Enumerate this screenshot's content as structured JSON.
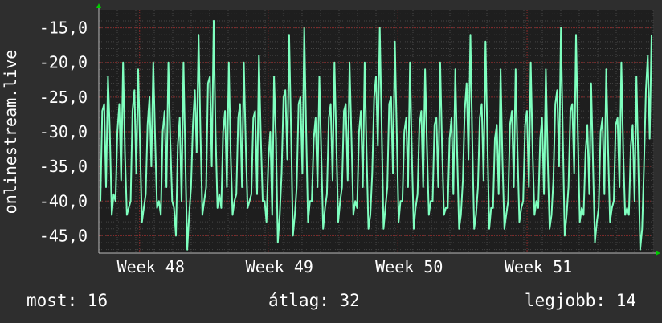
{
  "chart_data": {
    "type": "line",
    "ylabel": "onlinestream.live",
    "ylim": [
      -47.5,
      -12.5
    ],
    "y_ticks": [
      {
        "value": -15,
        "label": "-15,0"
      },
      {
        "value": -20,
        "label": "-20,0"
      },
      {
        "value": -25,
        "label": "-25,0"
      },
      {
        "value": -30,
        "label": "-30,0"
      },
      {
        "value": -35,
        "label": "-35,0"
      },
      {
        "value": -40,
        "label": "-40,0"
      },
      {
        "value": -45,
        "label": "-45,0"
      }
    ],
    "x_ticks": [
      "Week 48",
      "Week 49",
      "Week 50",
      "Week 51"
    ],
    "x_tick_positions": [
      0.146,
      0.378,
      0.612,
      0.845
    ],
    "grid": true,
    "series": [
      {
        "color": "#7fffbf",
        "values": [
          -40,
          -27,
          -26,
          -38,
          -22,
          -30,
          -42,
          -39,
          -40,
          -30,
          -26,
          -37,
          -20,
          -33,
          -42,
          -41,
          -40,
          -27,
          -24,
          -36,
          -21,
          -32,
          -43,
          -41,
          -39,
          -29,
          -25,
          -35,
          -20,
          -31,
          -41,
          -40,
          -42,
          -30,
          -27,
          -38,
          -20,
          -31,
          -40,
          -41,
          -45,
          -32,
          -28,
          -40,
          -20,
          -34,
          -47,
          -42,
          -38,
          -29,
          -24,
          -33,
          -16,
          -30,
          -42,
          -40,
          -38,
          -23,
          -22,
          -35,
          -14,
          -30,
          -41,
          -39,
          -41,
          -30,
          -27,
          -38,
          -20,
          -33,
          -42,
          -40,
          -39,
          -28,
          -26,
          -38,
          -20,
          -32,
          -41,
          -40,
          -39,
          -28,
          -27,
          -39,
          -19,
          -31,
          -40,
          -40,
          -43,
          -34,
          -30,
          -42,
          -22,
          -31,
          -46,
          -42,
          -36,
          -25,
          -24,
          -34,
          -16,
          -30,
          -45,
          -42,
          -38,
          -26,
          -25,
          -36,
          -15,
          -30,
          -43,
          -40,
          -40,
          -31,
          -28,
          -38,
          -22,
          -33,
          -44,
          -41,
          -39,
          -28,
          -26,
          -37,
          -20,
          -32,
          -43,
          -40,
          -38,
          -27,
          -26,
          -37,
          -20,
          -31,
          -42,
          -40,
          -41,
          -30,
          -27,
          -38,
          -20,
          -33,
          -44,
          -42,
          -36,
          -25,
          -22,
          -32,
          -15,
          -29,
          -44,
          -41,
          -38,
          -26,
          -25,
          -36,
          -17,
          -30,
          -43,
          -40,
          -40,
          -30,
          -28,
          -38,
          -20,
          -33,
          -44,
          -41,
          -39,
          -29,
          -27,
          -38,
          -21,
          -32,
          -42,
          -40,
          -40,
          -29,
          -28,
          -38,
          -20,
          -32,
          -42,
          -41,
          -41,
          -31,
          -28,
          -39,
          -21,
          -33,
          -44,
          -42,
          -37,
          -27,
          -23,
          -34,
          -16,
          -31,
          -44,
          -42,
          -38,
          -28,
          -26,
          -37,
          -17,
          -31,
          -44,
          -41,
          -41,
          -31,
          -29,
          -39,
          -21,
          -34,
          -44,
          -42,
          -40,
          -29,
          -27,
          -38,
          -21,
          -33,
          -43,
          -41,
          -40,
          -29,
          -27,
          -38,
          -20,
          -33,
          -42,
          -40,
          -41,
          -31,
          -28,
          -39,
          -21,
          -34,
          -44,
          -42,
          -37,
          -26,
          -24,
          -35,
          -15,
          -31,
          -45,
          -42,
          -38,
          -27,
          -26,
          -36,
          -16,
          -31,
          -43,
          -41,
          -42,
          -33,
          -29,
          -39,
          -23,
          -35,
          -46,
          -43,
          -41,
          -30,
          -28,
          -39,
          -21,
          -33,
          -43,
          -41,
          -40,
          -29,
          -28,
          -38,
          -20,
          -33,
          -42,
          -41,
          -42,
          -32,
          -29,
          -40,
          -22,
          -35,
          -47,
          -44,
          -35,
          -24,
          -19,
          -31,
          -16
        ]
      }
    ]
  },
  "stats": {
    "now": "most: 16",
    "avg": "átlag: 32",
    "max": "legjobb: 14"
  },
  "colors": {
    "background": "#2e2e2e",
    "plot_background": "#1e1e1e",
    "line": "#7fffbf",
    "grid_major": "#8a2a2a",
    "grid_minor": "#454545",
    "arrow": "#00cc00",
    "text": "#ffffff"
  }
}
